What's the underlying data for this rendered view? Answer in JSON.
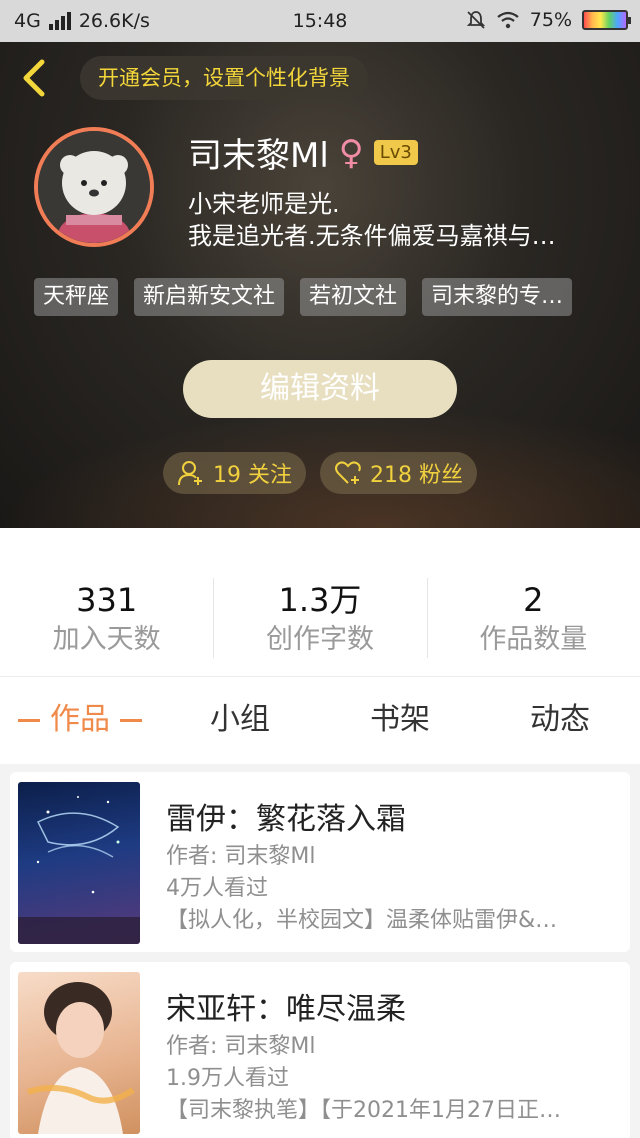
{
  "status_bar": {
    "network": "4G",
    "speed": "26.6K/s",
    "time": "15:48",
    "battery": "75%"
  },
  "header": {
    "banner": "开通会员，设置个性化背景",
    "username": "司末黎Ml",
    "gender_symbol": "♀",
    "level": "Lv3",
    "bio_line1": "小宋老师是光.",
    "bio_line2": "我是追光者.无条件偏爱马嘉祺与…",
    "tags": [
      "天秤座",
      "新启新安文社",
      "若初文社",
      "司末黎的专…"
    ],
    "edit_label": "编辑资料",
    "following_label": "19 关注",
    "followers_label": "218 粉丝"
  },
  "stats": [
    {
      "value": "331",
      "label": "加入天数"
    },
    {
      "value": "1.3万",
      "label": "创作字数"
    },
    {
      "value": "2",
      "label": "作品数量"
    }
  ],
  "tabs": [
    "作品",
    "小组",
    "书架",
    "动态"
  ],
  "books": [
    {
      "title": "雷伊：繁花落入霜",
      "author": "作者: 司末黎Ml",
      "views": "4万人看过",
      "desc": "【拟人化，半校园文】温柔体贴雷伊&…"
    },
    {
      "title": "宋亚轩：唯尽温柔",
      "author": "作者: 司末黎Ml",
      "views": "1.9万人看过",
      "desc": "【司末黎执笔】【于2021年1月27日正…"
    }
  ],
  "colors": {
    "accent": "#f08a4b",
    "banner_text": "#f3d63a",
    "level_badge": "#f1c94a",
    "avatar_ring": "#f07d55"
  }
}
